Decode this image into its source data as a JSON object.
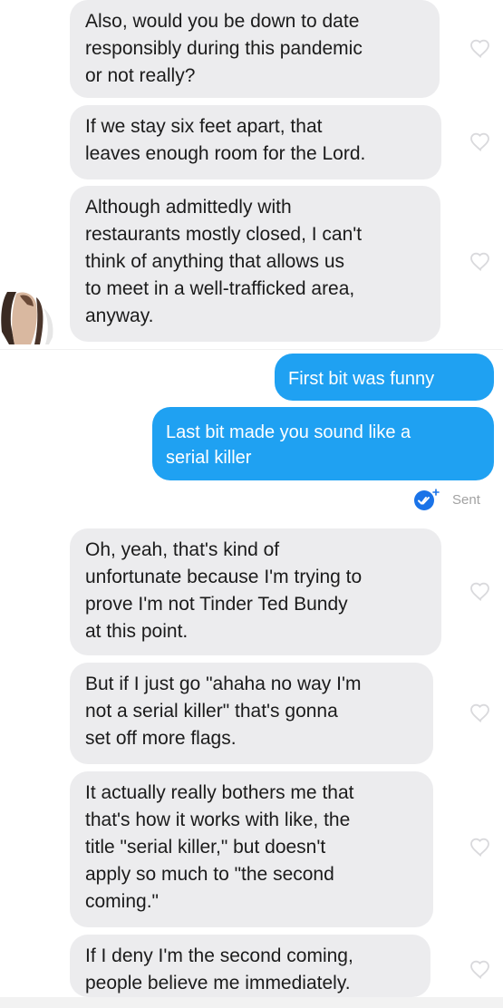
{
  "thread": {
    "incoming_top": [
      "Also, would you be down to date\nresponsibly during this pandemic\nor not really?",
      "If we stay six feet apart, that\nleaves enough room for the Lord.",
      "Although admittedly with\nrestaurants mostly closed, I can't\nthink of anything that allows us\nto meet in a well-trafficked area,\nanyway."
    ],
    "outgoing": [
      "First bit was funny",
      "Last bit made you sound like a\nserial killer"
    ],
    "sent_status": "Sent",
    "incoming_bottom": [
      "Oh, yeah, that's kind of\nunfortunate because I'm trying to\nprove I'm not Tinder Ted Bundy\nat this point.",
      "But if I just go \"ahaha no way I'm\nnot a serial killer\" that's gonna\nset off more flags.",
      "It actually really bothers me that\nthat's how it works with like, the\ntitle \"serial killer,\" but doesn't\napply so much to \"the second\ncoming.\"",
      "If I deny I'm the second coming,\npeople believe me immediately."
    ]
  },
  "icons": {
    "like": "heart-outline-icon",
    "read_receipt": "double-check-badge-icon"
  },
  "colors": {
    "incoming_bubble": "#ececee",
    "outgoing_bubble": "#1fa1f2",
    "heart_outline": "#d9d9dc",
    "read_badge": "#1a73e8"
  }
}
